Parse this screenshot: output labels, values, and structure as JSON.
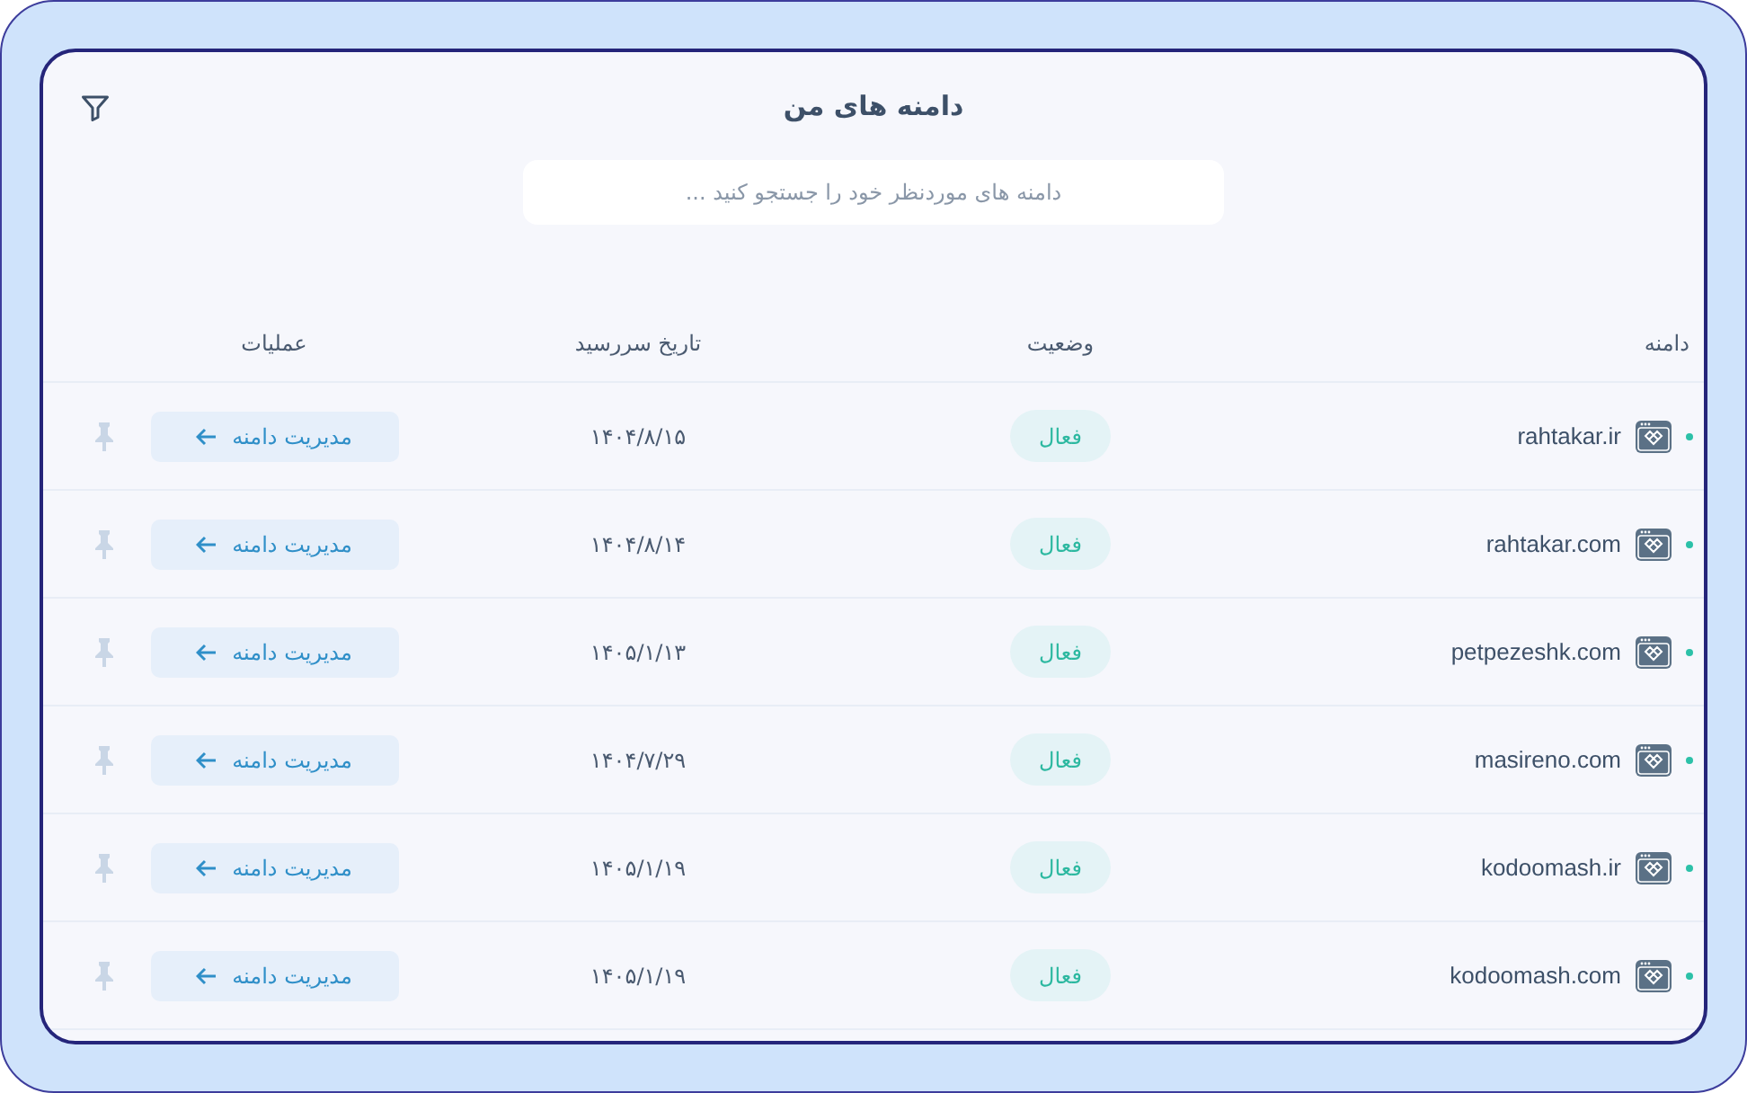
{
  "page": {
    "title": "دامنه های من"
  },
  "search": {
    "placeholder": "دامنه های موردنظر خود را جستجو کنید ..."
  },
  "table": {
    "columns": [
      "دامنه",
      "وضعیت",
      "تاریخ سررسید",
      "عملیات"
    ],
    "rows": [
      {
        "domain": "rahtakar.ir",
        "status": "فعال",
        "due_date": "۱۴۰۴/۸/۱۵",
        "action": "مدیریت دامنه"
      },
      {
        "domain": "rahtakar.com",
        "status": "فعال",
        "due_date": "۱۴۰۴/۸/۱۴",
        "action": "مدیریت دامنه"
      },
      {
        "domain": "petpezeshk.com",
        "status": "فعال",
        "due_date": "۱۴۰۵/۱/۱۳",
        "action": "مدیریت دامنه"
      },
      {
        "domain": "masireno.com",
        "status": "فعال",
        "due_date": "۱۴۰۴/۷/۲۹",
        "action": "مدیریت دامنه"
      },
      {
        "domain": "kodoomash.ir",
        "status": "فعال",
        "due_date": "۱۴۰۵/۱/۱۹",
        "action": "مدیریت دامنه"
      },
      {
        "domain": "kodoomash.com",
        "status": "فعال",
        "due_date": "۱۴۰۵/۱/۱۹",
        "action": "مدیریت دامنه"
      }
    ]
  }
}
